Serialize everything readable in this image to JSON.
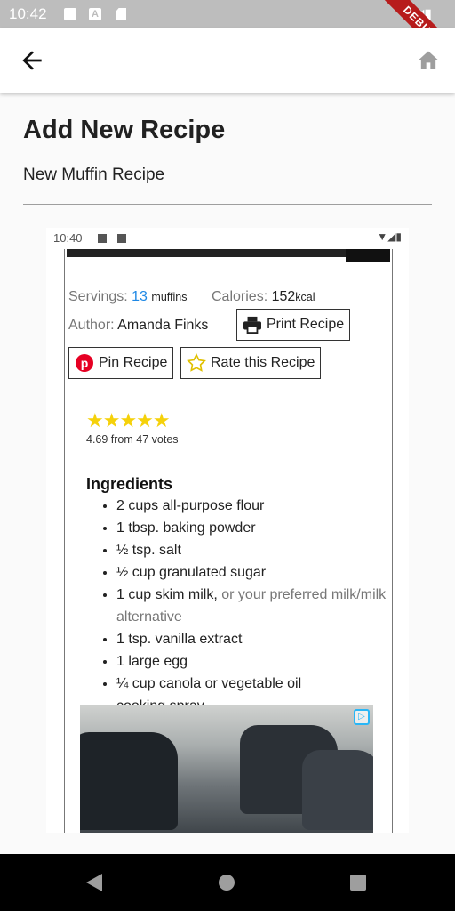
{
  "status_bar": {
    "time": "10:42",
    "debug_label": "DEBUG"
  },
  "page": {
    "title": "Add New Recipe",
    "recipe_name": "New Muffin Recipe"
  },
  "embedded": {
    "time": "10:40",
    "servings_label": "Servings:",
    "servings_value": "13",
    "servings_unit": "muffins",
    "calories_label": "Calories:",
    "calories_value": "152",
    "calories_unit": "kcal",
    "author_label": "Author:",
    "author_value": "Amanda Finks",
    "print_button": "Print Recipe",
    "pin_button": "Pin Recipe",
    "rate_button": "Rate this Recipe",
    "rating": 4.69,
    "stars": "★★★★★",
    "votes_text": "4.69 from 47 votes",
    "ingredients_heading": "Ingredients",
    "ingredients": [
      "2 cups all-purpose flour",
      "1 tbsp. baking powder",
      "½ tsp. salt",
      "½ cup granulated sugar",
      "1 cup skim milk,",
      "1 tsp. vanilla extract",
      "1 large egg",
      "¼ cup canola or vegetable oil",
      "cooking spray"
    ],
    "ingredient_note": "or your preferred milk/milk alternative"
  },
  "colors": {
    "accent": "#1e88e5",
    "star": "#f5d10a",
    "pinterest": "#e60023"
  }
}
